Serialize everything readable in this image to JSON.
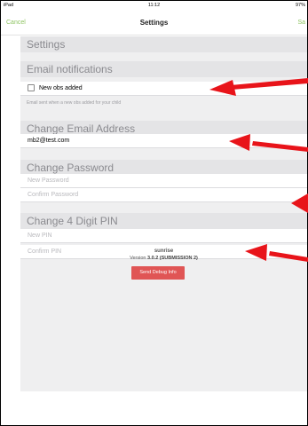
{
  "status_bar": {
    "device": "iPad",
    "time": "11:12",
    "battery": "97%"
  },
  "nav": {
    "cancel_label": "Cancel",
    "title": "Settings",
    "save_label": "Sa"
  },
  "settings_header": "Settings",
  "email_notifications": {
    "header": "Email notifications",
    "option_label": "New obs added",
    "option_checked": false,
    "hint": "Email sent when a new obs added for your child"
  },
  "change_email": {
    "header": "Change Email Address",
    "value": "mb2@test.com"
  },
  "change_password": {
    "header": "Change Password",
    "new_placeholder": "New Password",
    "confirm_placeholder": "Confirm Password"
  },
  "change_pin": {
    "header": "Change 4 Digit PIN",
    "new_placeholder": "New PIN",
    "confirm_placeholder": "Confirm PIN"
  },
  "footer": {
    "app_name": "sunrise",
    "version_prefix": "Version",
    "version_value": "3.0.2 (SUBMISSION 2)",
    "debug_button": "Send Debug Info"
  },
  "colors": {
    "accent": "#8fc463",
    "debug_button": "#e05555",
    "arrow": "#e8141a",
    "section_background": "#e4e4e6"
  }
}
